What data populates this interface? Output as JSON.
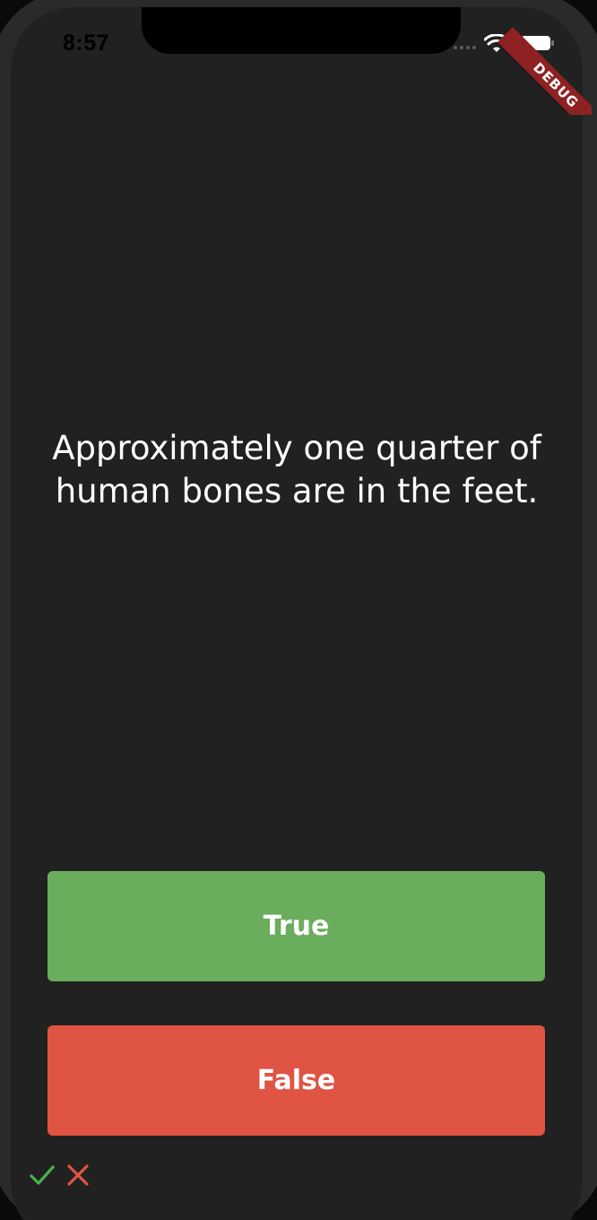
{
  "status_bar": {
    "time": "8:57",
    "wifi_icon": "wifi-icon",
    "battery_icon": "battery-icon"
  },
  "debug_banner": {
    "label": "DEBUG",
    "color": "#8e2222"
  },
  "quiz": {
    "question": "Approximately one quarter of human bones are in the feet.",
    "true_label": "True",
    "false_label": "False",
    "true_color": "#6aad5c",
    "false_color": "#e05443",
    "background": "#212121"
  },
  "score_keeper": [
    {
      "icon": "check-icon",
      "color": "#4caf50"
    },
    {
      "icon": "close-icon",
      "color": "#e05443"
    }
  ]
}
